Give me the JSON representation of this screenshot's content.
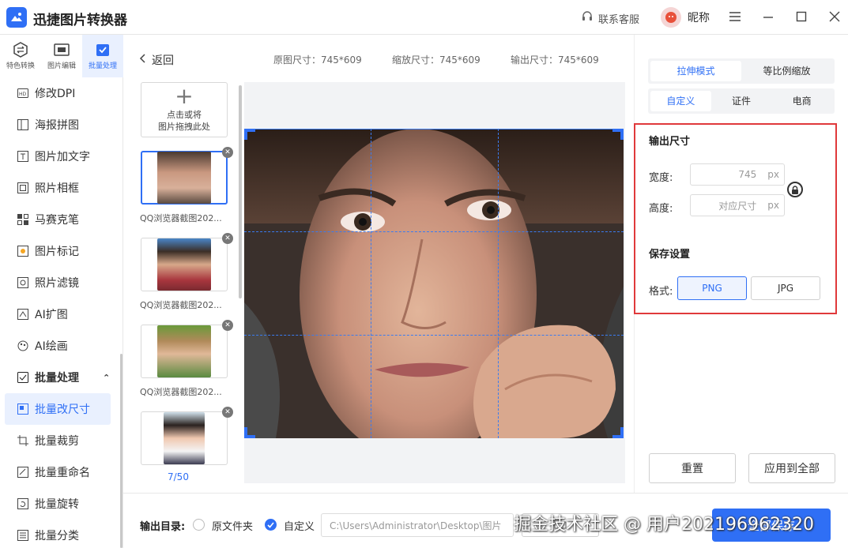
{
  "app": {
    "title": "迅捷图片转换器",
    "support": "联系客服",
    "nickname": "昵称"
  },
  "topnav": [
    {
      "label": "特色转换",
      "icon": "convert-icon"
    },
    {
      "label": "图片编辑",
      "icon": "edit-image-icon"
    },
    {
      "label": "批量处理",
      "icon": "batch-icon",
      "active": true
    }
  ],
  "menu": {
    "items": [
      {
        "label": "修改DPI",
        "icon": "dpi-icon"
      },
      {
        "label": "海报拼图",
        "icon": "poster-icon"
      },
      {
        "label": "图片加文字",
        "icon": "text-icon"
      },
      {
        "label": "照片相框",
        "icon": "frame-icon"
      },
      {
        "label": "马赛克笔",
        "icon": "mosaic-icon"
      },
      {
        "label": "图片标记",
        "icon": "mark-icon"
      },
      {
        "label": "照片滤镜",
        "icon": "filter-icon"
      },
      {
        "label": "AI扩图",
        "icon": "ai-expand-icon"
      },
      {
        "label": "AI绘画",
        "icon": "ai-paint-icon"
      }
    ],
    "group_label": "批量处理",
    "group_items": [
      {
        "label": "批量改尺寸",
        "icon": "resize-icon",
        "active": true
      },
      {
        "label": "批量裁剪",
        "icon": "crop-icon"
      },
      {
        "label": "批量重命名",
        "icon": "rename-icon"
      },
      {
        "label": "批量旋转",
        "icon": "rotate-icon"
      },
      {
        "label": "批量分类",
        "icon": "classify-icon"
      }
    ]
  },
  "toolbar": {
    "back": "返回",
    "original_size": "原图尺寸：745*609",
    "scaled_size": "缩放尺寸：745*609",
    "output_size": "输出尺寸：745*609"
  },
  "files": {
    "add_line1": "点击或将",
    "add_line2": "图片拖拽此处",
    "captions": [
      "QQ浏览器截图202...",
      "QQ浏览器截图202...",
      "QQ浏览器截图202..."
    ],
    "count": "7/50"
  },
  "panel": {
    "mode_tabs": [
      "拉伸模式",
      "等比例缩放"
    ],
    "preset_tabs": [
      "自定义",
      "证件",
      "电商"
    ],
    "output_title": "输出尺寸",
    "width_label": "宽度:",
    "width_value": "745",
    "height_label": "高度:",
    "height_placeholder": "对应尺寸",
    "unit": "px",
    "save_title": "保存设置",
    "format_label": "格式:",
    "formats": [
      "PNG",
      "JPG"
    ],
    "reset": "重置",
    "apply_all": "应用到全部"
  },
  "bottom": {
    "output_dir_label": "输出目录:",
    "option_original": "原文件夹",
    "option_custom": "自定义",
    "path": "C:\\Users\\Administrator\\Desktop\\图片",
    "save_all": "全部保存"
  },
  "watermark": "掘金技术社区 @ 用户2021969623​20",
  "colors": {
    "accent": "#2f6ff5",
    "highlight_border": "#e0393b"
  }
}
